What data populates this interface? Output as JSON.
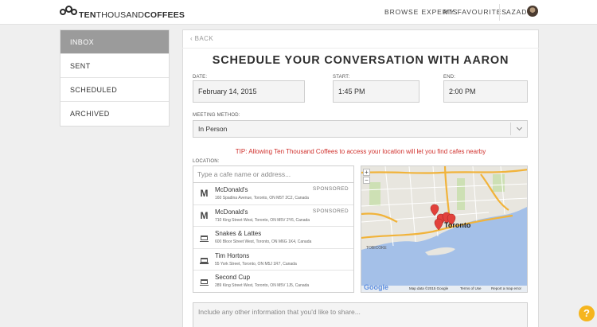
{
  "nav": {
    "brand_ten": "TEN",
    "brand_thousand": "THOUSAND",
    "brand_coffees": "COFFEES",
    "browse": "BROWSE EXPERTS",
    "favourites": "MY FAVOURITES",
    "user": "AZAD"
  },
  "sidebar": {
    "items": [
      {
        "label": "INBOX"
      },
      {
        "label": "SENT"
      },
      {
        "label": "SCHEDULED"
      },
      {
        "label": "ARCHIVED"
      }
    ]
  },
  "main": {
    "back": "‹ BACK",
    "title": "SCHEDULE YOUR CONVERSATION WITH AARON",
    "date_label": "DATE:",
    "date_value": "February 14, 2015",
    "start_label": "START:",
    "start_value": "1:45 PM",
    "end_label": "END:",
    "end_value": "2:00 PM",
    "method_label": "MEETING METHOD:",
    "method_value": "In Person",
    "tip": "TIP: Allowing Ten Thousand Coffees to access your location will let you find cafes nearby",
    "location_label": "LOCATION:",
    "search_placeholder": "Type a cafe name or address...",
    "notes_placeholder": "Include any other information that you'd like to share..."
  },
  "results": [
    {
      "name": "McDonald's",
      "address": "160 Spadina Avenue, Toronto, ON M5T 2C2, Canada",
      "badge": "SPONSORED",
      "icon": "mcdonalds-icon"
    },
    {
      "name": "McDonald's",
      "address": "710 King Street West, Toronto, ON M5V 2Y6, Canada",
      "badge": "SPONSORED",
      "icon": "mcdonalds-icon"
    },
    {
      "name": "Snakes & Lattes",
      "address": "600 Bloor Street West, Toronto, ON M6G 1K4, Canada",
      "badge": "",
      "icon": "coffee-cup-icon"
    },
    {
      "name": "Tim Hortons",
      "address": "55 York Street, Toronto, ON M5J 1R7, Canada",
      "badge": "",
      "icon": "coffee-cup-icon"
    },
    {
      "name": "Second Cup",
      "address": "289 King Street West, Toronto, ON M5V 1J5, Canada",
      "badge": "",
      "icon": "coffee-cup-icon"
    }
  ],
  "map": {
    "city_label": "Toronto",
    "tobicoke_label": "TOBICOKE",
    "footer": "Map data ©2015 Google",
    "terms": "Terms of Use",
    "report": "Report a map error",
    "google": "Google",
    "zoom_in": "+",
    "zoom_out": "−"
  },
  "help": "?",
  "colors": {
    "tip": "#d0312d",
    "active_sidebar": "#9b9b9b",
    "help": "#f5b51e"
  }
}
